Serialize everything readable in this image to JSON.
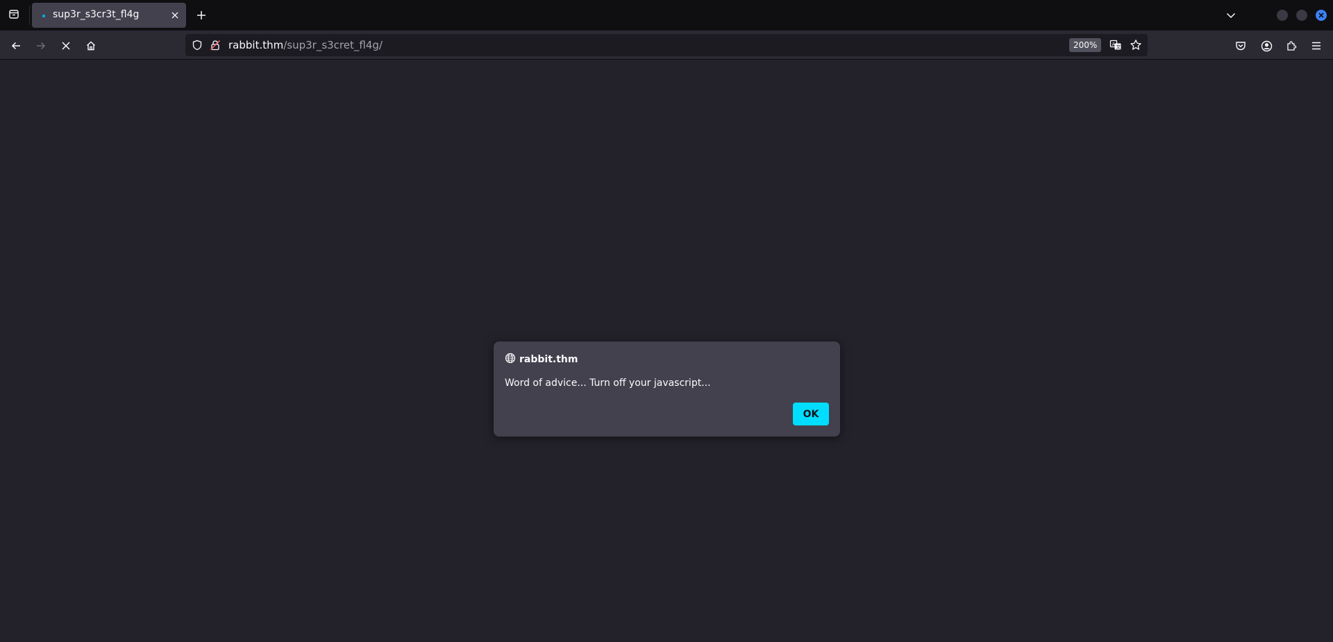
{
  "tabs": [
    {
      "title": "sup3r_s3cr3t_fl4g",
      "active": true,
      "loading": true
    }
  ],
  "urlbar": {
    "host": "rabbit.thm",
    "path": "/sup3r_s3cret_fl4g/",
    "zoom": "200%"
  },
  "dialog": {
    "origin": "rabbit.thm",
    "message": "Word of advice... Turn off your javascript...",
    "ok_label": "OK"
  },
  "colors": {
    "accent": "#00ddff",
    "background": "#23222b",
    "dialog_bg": "#42414d",
    "toolbar_bg": "#2b2a33"
  },
  "icons": {
    "tabbar": [
      "tab-list-icon",
      "plus-icon",
      "chevron-down-icon"
    ],
    "nav": [
      "back-arrow-icon",
      "forward-arrow-icon",
      "stop-icon",
      "home-icon"
    ],
    "urlbar": [
      "shield-icon",
      "lock-icon",
      "translate-icon",
      "star-icon"
    ],
    "toolbar": [
      "pocket-icon",
      "account-icon",
      "extensions-icon",
      "hamburger-menu-icon"
    ],
    "dialog": [
      "globe-icon"
    ]
  }
}
